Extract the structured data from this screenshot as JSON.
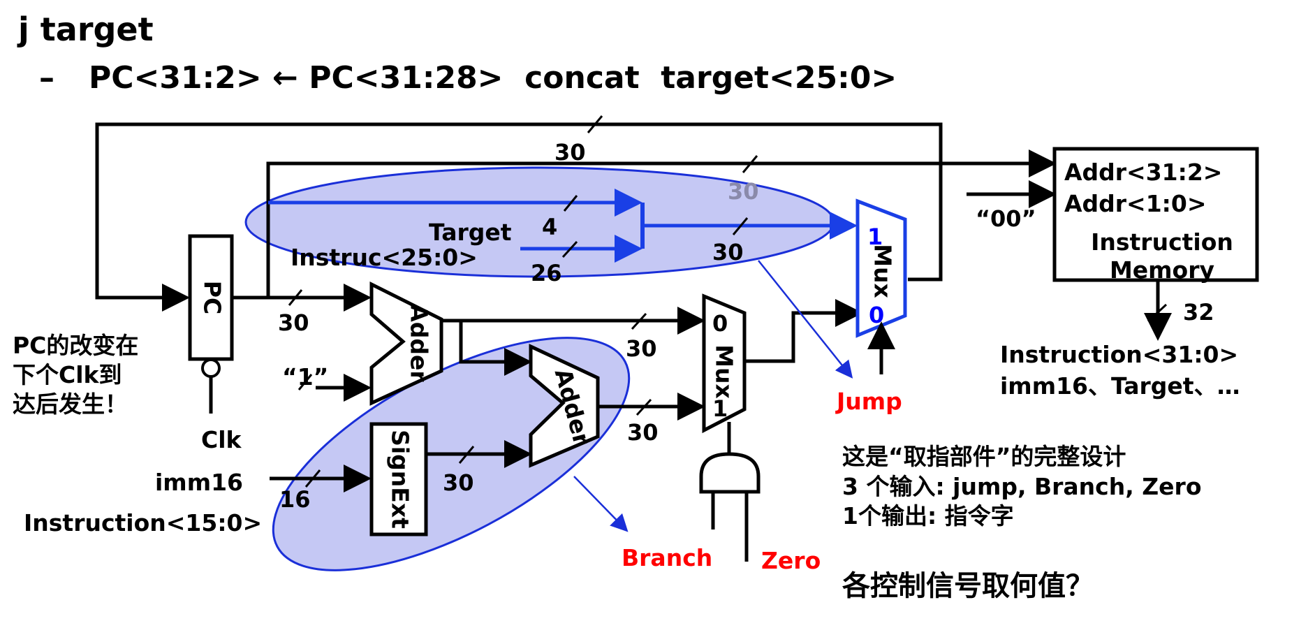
{
  "title": "j target",
  "subtitle_dash": "–",
  "subtitle": "PC<31:2> ← PC<31:28>  concat  target<25:0>",
  "diagram": {
    "pc_label": "PC",
    "clk_label": "Clk",
    "pc_note": [
      "PC的改变在",
      "下个Clk到",
      "达后发生！"
    ],
    "const_one": "“1”",
    "adder1_label": "Adder",
    "adder2_label": "Adder",
    "signext_label": "SignExt",
    "imm16_label": "imm16",
    "instr_15_0_label": "Instruction<15:0>",
    "target_label": "Target",
    "instruc_25_0_label": "Instruc<25:0>",
    "mux_branch_label": "Mux",
    "mux_branch_in0": "0",
    "mux_branch_in1": "1",
    "mux_jump_label": "Mux",
    "mux_jump_in1": "1",
    "mux_jump_in0": "0",
    "jump_label": "Jump",
    "branch_label": "Branch",
    "zero_label": "Zero",
    "imem_addr_31_2": "Addr<31:2>",
    "imem_addr_1_0": "Addr<1:0>",
    "imem_title_1": "Instruction",
    "imem_title_2": "Memory",
    "const_00": "“00”",
    "instr_bus_width": "32",
    "instr_out_1": "Instruction<31:0>",
    "instr_out_2": "imm16、Target、…",
    "widths": {
      "top_loop": "30",
      "imem_addr": "30",
      "target_in_4": "4",
      "target_in_26": "26",
      "concat_out": "30",
      "pc_out": "30",
      "adder1_out": "30",
      "adder2_out": "30",
      "signext_out": "30",
      "imm16_in": "16"
    }
  },
  "notes": {
    "line1": "这是“取指部件”的完整设计",
    "line2": "3 个输入: jump, Branch, Zero",
    "line3": "1个输出: 指令字",
    "question": "各控制信号取何值？"
  },
  "colors": {
    "highlight_fill": "#c5c8f4",
    "highlight_stroke": "#1a2fd8",
    "blue_wire": "#1a3fe6",
    "control_red": "#ff0000"
  }
}
